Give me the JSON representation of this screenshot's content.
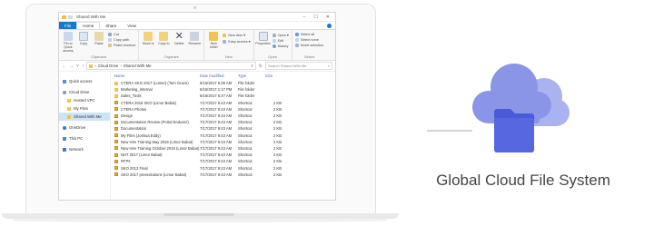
{
  "explorer": {
    "title": "Shared With Me",
    "tabs": [
      "File",
      "Home",
      "Share",
      "View"
    ],
    "ribbon": {
      "clipboard": {
        "pin_label": "Pin to Quick access",
        "copy_label": "Copy",
        "paste_label": "Paste",
        "cut_label": "Cut",
        "copy_path_label": "Copy path",
        "paste_shortcut_label": "Paste shortcut",
        "caption": "Clipboard"
      },
      "organize": {
        "move_label": "Move to",
        "copy_to_label": "Copy to",
        "delete_label": "Delete",
        "rename_label": "Rename",
        "caption": "Organize"
      },
      "new": {
        "new_folder_label": "New folder",
        "new_item_label": "New item ▾",
        "easy_access_label": "Easy access ▾",
        "caption": "New"
      },
      "open": {
        "properties_label": "Properties",
        "open_label": "Open ▾",
        "edit_label": "Edit",
        "history_label": "History",
        "caption": "Open"
      },
      "select": {
        "select_all_label": "Select all",
        "select_none_label": "Select none",
        "invert_label": "Invert selection",
        "caption": "Select"
      }
    },
    "address": {
      "path": [
        "Cloud Drive",
        "Shared With Me"
      ],
      "separator": "›",
      "search_placeholder": "Search Shared With Me"
    },
    "nav": [
      {
        "label": "Quick access",
        "icon": "star-icon"
      },
      {
        "label": "Cloud Drive",
        "icon": "cloud-icon"
      },
      {
        "label": "Hosted VPC",
        "icon": "folder-icon"
      },
      {
        "label": "My Files",
        "icon": "folder-icon"
      },
      {
        "label": "Shared With Me",
        "icon": "folder-icon"
      },
      {
        "label": "OneDrive",
        "icon": "onedrive-icon"
      },
      {
        "label": "This PC",
        "icon": "computer-icon"
      },
      {
        "label": "Network",
        "icon": "network-icon"
      }
    ],
    "columns": {
      "name": "Name",
      "date": "Date modified",
      "type": "Type",
      "size": "Size"
    },
    "files": [
      {
        "name": "CTERA SKO 2017 (Lomer) (Tom Grace)",
        "date": "5/16/2017 5:39 AM",
        "type": "File folder",
        "size": "",
        "kind": "folder"
      },
      {
        "name": "Marketing_Internal",
        "date": "6/16/2017 1:17 PM",
        "type": "File folder",
        "size": "",
        "kind": "folder"
      },
      {
        "name": "Sales_Tools",
        "date": "6/16/2017 5:47 AM",
        "type": "File folder",
        "size": "",
        "kind": "folder"
      },
      {
        "name": "CTERA 2018 SKO (Limor Babat)",
        "date": "7/17/2017 9:43 AM",
        "type": "Shortcut",
        "size": "2 KB",
        "kind": "shortcut"
      },
      {
        "name": "CTERA Photos",
        "date": "7/17/2017 9:43 AM",
        "type": "Shortcut",
        "size": "2 KB",
        "kind": "shortcut"
      },
      {
        "name": "Design",
        "date": "7/17/2017 9:43 AM",
        "type": "Shortcut",
        "size": "2 KB",
        "kind": "shortcut"
      },
      {
        "name": "Documentation Review (Portal Enduser)",
        "date": "7/17/2017 9:43 AM",
        "type": "Shortcut",
        "size": "2 KB",
        "kind": "shortcut"
      },
      {
        "name": "Documentation",
        "date": "7/17/2017 9:43 AM",
        "type": "Shortcut",
        "size": "2 KB",
        "kind": "shortcut"
      },
      {
        "name": "My Files (Joshua Eddy)",
        "date": "7/17/2017 9:43 AM",
        "type": "Shortcut",
        "size": "2 KB",
        "kind": "shortcut"
      },
      {
        "name": "New Hire Training May 2015 (Limor Babat)",
        "date": "7/17/2017 9:43 AM",
        "type": "Shortcut",
        "size": "2 KB",
        "kind": "shortcut"
      },
      {
        "name": "New Hire Training October 2015 (Limor Babat)",
        "date": "7/17/2017 9:43 AM",
        "type": "Shortcut",
        "size": "2 KB",
        "kind": "shortcut"
      },
      {
        "name": "NHT 2017 (Limor Babat)",
        "date": "7/17/2017 9:43 AM",
        "type": "Shortcut",
        "size": "2 KB",
        "kind": "shortcut"
      },
      {
        "name": "RFPs",
        "date": "7/17/2017 9:43 AM",
        "type": "Shortcut",
        "size": "2 KB",
        "kind": "shortcut"
      },
      {
        "name": "SKO 2013 Final",
        "date": "7/17/2017 9:43 AM",
        "type": "Shortcut",
        "size": "2 KB",
        "kind": "shortcut"
      },
      {
        "name": "SKO 2017 presentations (Limor Babat)",
        "date": "7/17/2017 9:43 AM",
        "type": "Shortcut",
        "size": "2 KB",
        "kind": "shortcut"
      }
    ]
  },
  "caption": "Global Cloud File System",
  "colors": {
    "accent": "#1979ca",
    "cloud_back": "#aab3ef",
    "cloud_front": "#8a95e8",
    "folder": "#4a5bd9"
  }
}
